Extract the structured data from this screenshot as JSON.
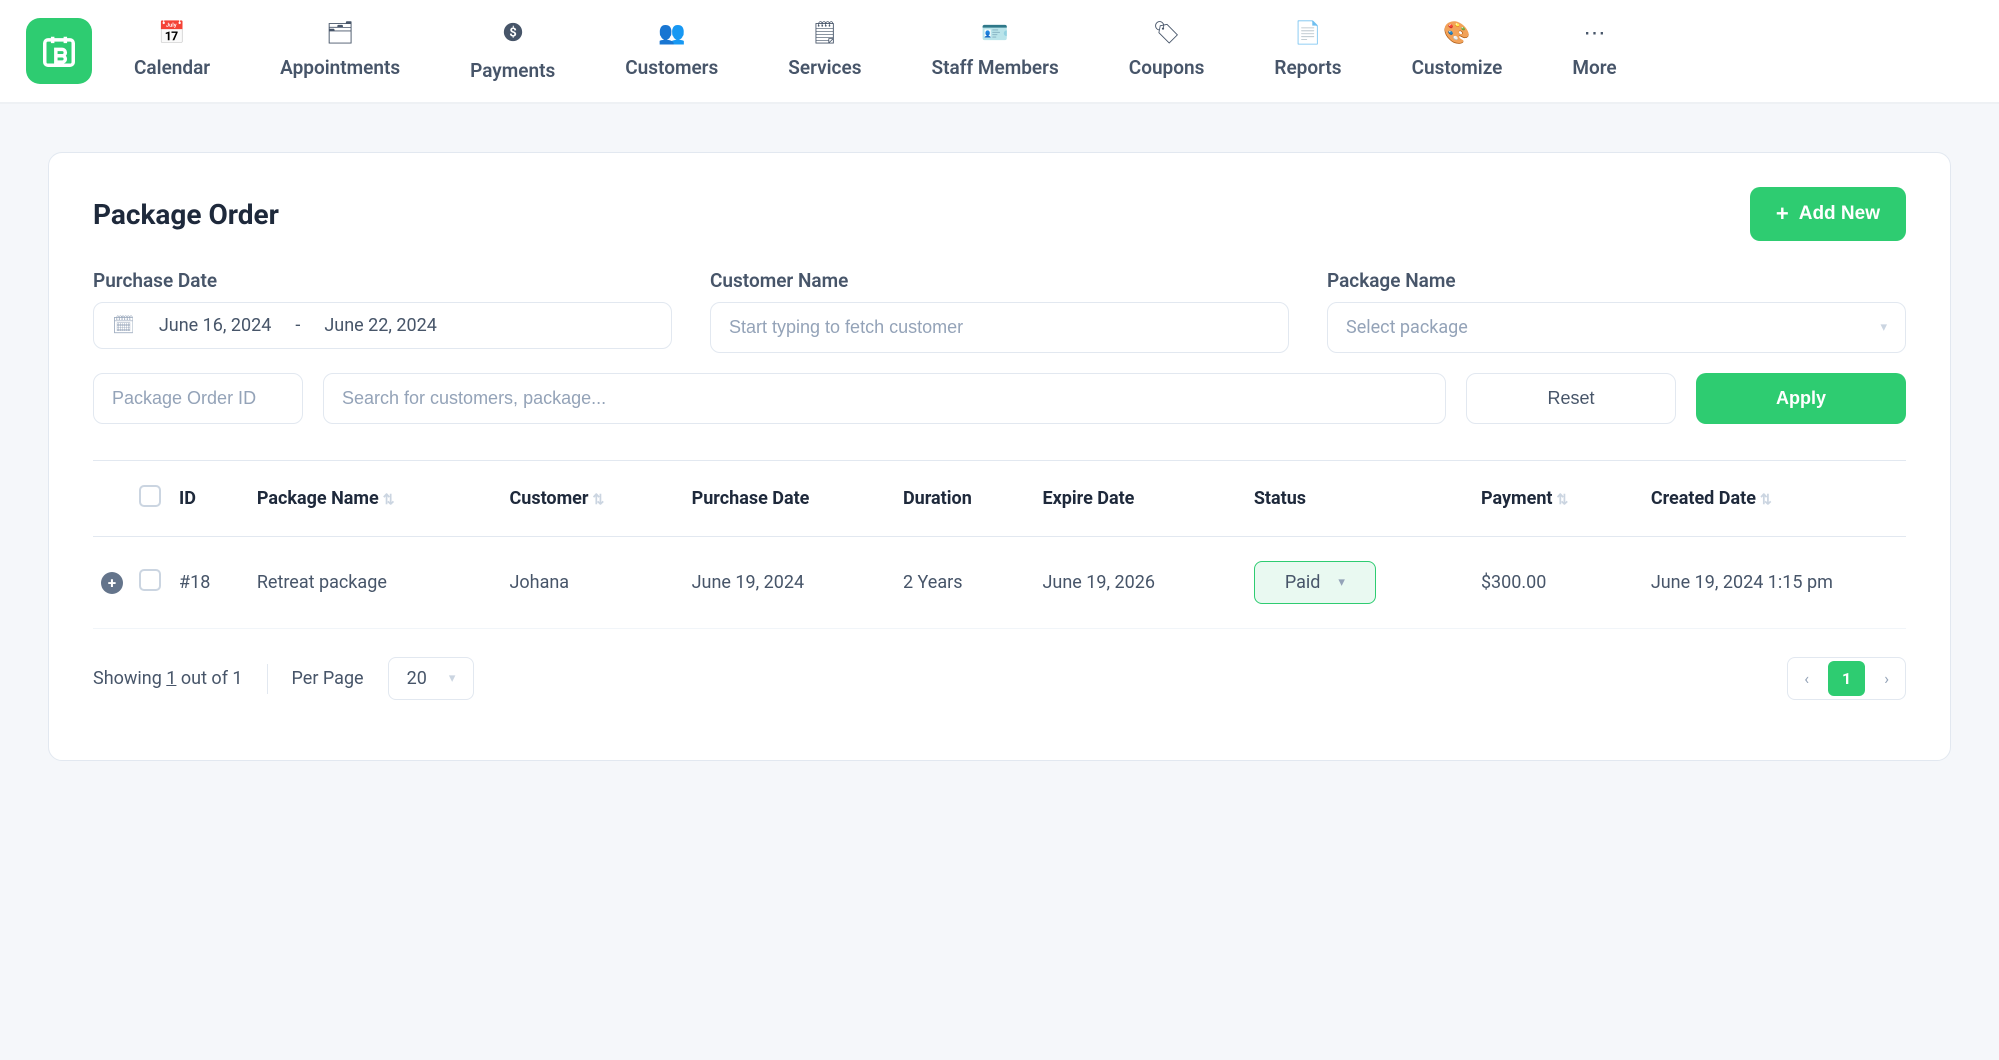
{
  "nav": {
    "items": [
      {
        "label": "Calendar",
        "icon": "📅"
      },
      {
        "label": "Appointments",
        "icon": "🗂"
      },
      {
        "label": "Payments",
        "icon": "$"
      },
      {
        "label": "Customers",
        "icon": "👥"
      },
      {
        "label": "Services",
        "icon": "🗒"
      },
      {
        "label": "Staff Members",
        "icon": "🪪"
      },
      {
        "label": "Coupons",
        "icon": "🏷"
      },
      {
        "label": "Reports",
        "icon": "📄"
      },
      {
        "label": "Customize",
        "icon": "🎨"
      },
      {
        "label": "More",
        "icon": "⋯"
      }
    ]
  },
  "page": {
    "title": "Package Order",
    "add_new": "Add New"
  },
  "filters": {
    "purchase_date_label": "Purchase Date",
    "date_from": "June 16, 2024",
    "date_to": "June 22, 2024",
    "customer_name_label": "Customer Name",
    "customer_placeholder": "Start typing to fetch customer",
    "package_name_label": "Package Name",
    "package_placeholder": "Select package",
    "order_id_placeholder": "Package Order ID",
    "search_placeholder": "Search for customers, package...",
    "reset": "Reset",
    "apply": "Apply"
  },
  "table": {
    "headers": {
      "id": "ID",
      "package_name": "Package Name",
      "customer": "Customer",
      "purchase_date": "Purchase Date",
      "duration": "Duration",
      "expire_date": "Expire Date",
      "status": "Status",
      "payment": "Payment",
      "created_date": "Created Date"
    },
    "rows": [
      {
        "id": "#18",
        "package_name": "Retreat package",
        "customer": "Johana",
        "purchase_date": "June 19, 2024",
        "duration": "2 Years",
        "expire_date": "June 19, 2026",
        "status": "Paid",
        "payment": "$300.00",
        "created_date": "June 19, 2024 1:15 pm"
      }
    ]
  },
  "pagination": {
    "showing_prefix": "Showing ",
    "showing_count": "1",
    "showing_mid": " out of ",
    "showing_total": "1",
    "per_page_label": "Per Page",
    "per_page_value": "20",
    "current_page": "1"
  }
}
